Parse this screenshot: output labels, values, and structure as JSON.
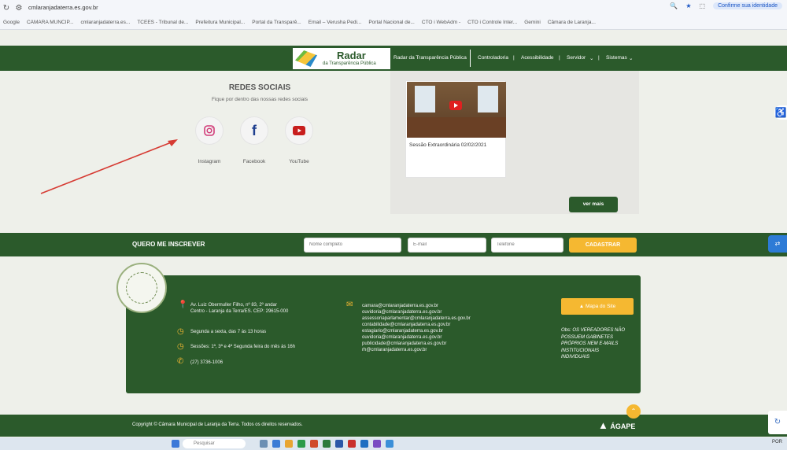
{
  "browser": {
    "url": "cmlaranjadaterra.es.gov.br",
    "identity_pill": "Confirme sua identidade",
    "bookmarks": [
      "Google",
      "CÂMARA MUNCIP...",
      "cmlaranjadaterra.es...",
      "TCEES - Tribunal de...",
      "Prefeitura Municipal...",
      "Portal da Transparê...",
      "Email – Verusha Pedi...",
      "Portal Nacional de...",
      "CTO i WebAdm -",
      "CTO i Controle Inter...",
      "Gemini",
      "Câmara de Laranja..."
    ]
  },
  "header": {
    "logo_title": "Radar",
    "logo_sub": "da Transparência Pública",
    "radar_link": "Radar da Transparência Pública",
    "menu": [
      "Controladoria",
      "Acessibilidade",
      "Servidor",
      "Sistemas"
    ],
    "separator": "|"
  },
  "social": {
    "title": "REDES SOCIAIS",
    "subtitle": "Fique por dentro das nossas redes sociais",
    "items": [
      {
        "label": "Instagram",
        "icon": "instagram-icon"
      },
      {
        "label": "Facebook",
        "icon": "facebook-icon"
      },
      {
        "label": "YouTube",
        "icon": "youtube-icon"
      }
    ]
  },
  "video": {
    "caption": "Sessão Extraordinária 02/02/2021",
    "more_label": "ver mais"
  },
  "subscribe": {
    "label": "QUERO ME INSCREVER",
    "name_placeholder": "Nome completo",
    "email_placeholder": "E-mail",
    "phone_placeholder": "Telefone",
    "button": "CADASTRAR"
  },
  "footer": {
    "address_line1": "Av. Luiz Obermuller Filho, nº 83, 2º andar",
    "address_line2": "Centro - Laranja da Terra/ES. CEP: 29615-000",
    "hours": "Segunda a sexta, das 7 às 13 horas",
    "sessions": "Sessões: 1ª, 3ª e 4ª Segunda feira do mês às 16h",
    "phone": "(27) 3736-1006",
    "emails": [
      "camara@cmlaranjadaterra.es.gov.br",
      "ouvidoria@cmlaranjadaterra.es.gov.br",
      "assessoriaparlamentar@cmlaranjadaterra.es.gov.br",
      "contabilidade@cmlaranjadaterra.es.gov.br",
      "estagiario@cmlaranjadaterra.es.gov.br",
      "ouvidoria@cmlaranjadaterra.es.gov.br",
      "publicidade@cmlaranjadaterra.es.gov.br",
      "rh@cmlaranjadaterra.es.gov.br"
    ],
    "sitemap_button": "Mapa do Site",
    "obs_lines": [
      "Obs: OS VEREADORES NÃO",
      "POSSUEM GABINETES",
      "PRÓPRIOS NEM E-MAILS",
      "INSTITUCIONAIS",
      "INDIVIDUAIS"
    ],
    "seal_text": "LARANJA DA TERRA"
  },
  "copyright": {
    "text": "Copyright © Câmara Municipal de Laranja da Terra. Todos os direitos reservados.",
    "agape": "ÁGAPE"
  },
  "taskbar": {
    "search": "Pesquisar",
    "lang": "POR"
  },
  "colors": {
    "brand_green": "#2b5a2b",
    "accent_yellow": "#f5b831",
    "arrow_red": "#d63b33"
  }
}
